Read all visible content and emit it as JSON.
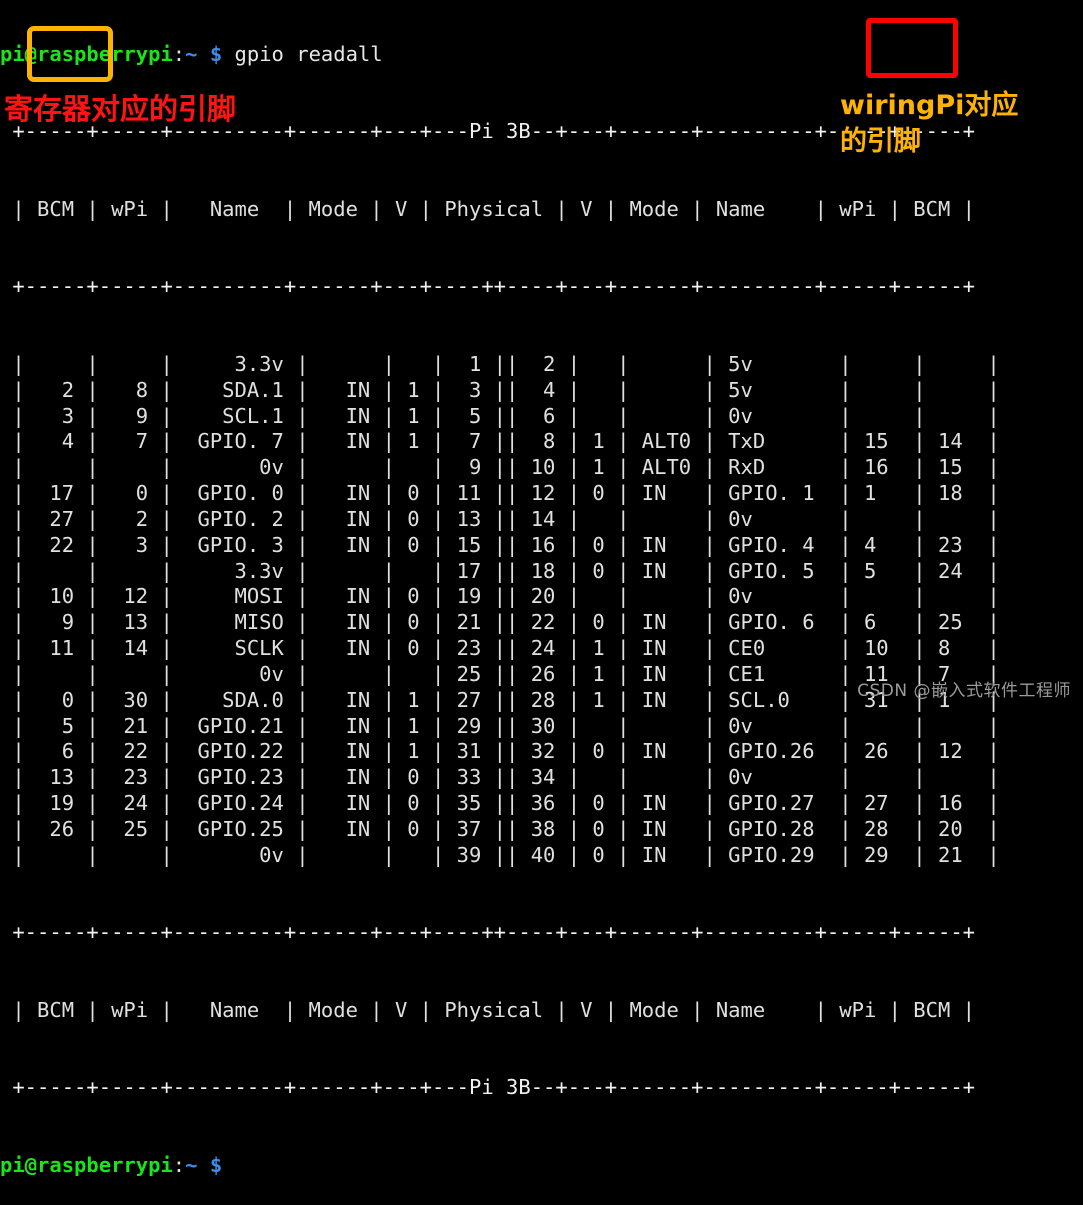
{
  "terminal": {
    "prompt": {
      "user_host": "pi@raspberrypi",
      "colon": ":",
      "path": "~",
      "dollar": "$"
    },
    "command": "gpio readall",
    "board_label": "Pi 3B",
    "top_line_full": "pi@raspberrypi:~ $ gpio readall",
    "final_prompt_trailing": " "
  },
  "table": {
    "headers": [
      "BCM",
      "wPi",
      "Name",
      "Mode",
      "V",
      "Physical",
      "V",
      "Mode",
      "Name",
      "wPi",
      "BCM"
    ],
    "border_top": " +-----+-----+---------+------+---+---Pi 3B--+---+------+---------+-----+-----+",
    "border_mid": " +-----+-----+---------+------+---+----++----+---+------+---------+-----+-----+",
    "header_row": " | BCM | wPi |   Name  | Mode | V | Physical | V | Mode | Name    | wPi | BCM |",
    "border_bottom": " +-----+-----+---------+------+---+---Pi 3B--+---+------+---------+-----+-----+",
    "rows": [
      {
        "bcm_l": "",
        "wpi_l": "",
        "name_l": "    3.3v",
        "mode_l": "",
        "v_l": "",
        "phys_l": " 1",
        "phys_r": " 2",
        "v_r": "",
        "mode_r": "",
        "name_r": "5v      ",
        "wpi_r": "",
        "bcm_r": ""
      },
      {
        "bcm_l": "2",
        "wpi_l": "8",
        "name_l": "   SDA.1",
        "mode_l": "  IN",
        "v_l": "1",
        "phys_l": " 3",
        "phys_r": " 4",
        "v_r": "",
        "mode_r": "",
        "name_r": "5v      ",
        "wpi_r": "",
        "bcm_r": ""
      },
      {
        "bcm_l": "3",
        "wpi_l": "9",
        "name_l": "   SCL.1",
        "mode_l": "  IN",
        "v_l": "1",
        "phys_l": " 5",
        "phys_r": " 6",
        "v_r": "",
        "mode_r": "",
        "name_r": "0v      ",
        "wpi_r": "",
        "bcm_r": ""
      },
      {
        "bcm_l": "4",
        "wpi_l": "7",
        "name_l": " GPIO. 7",
        "mode_l": "  IN",
        "v_l": "1",
        "phys_l": " 7",
        "phys_r": " 8",
        "v_r": "1",
        "mode_r": "ALT0",
        "name_r": "TxD     ",
        "wpi_r": "15",
        "bcm_r": "14"
      },
      {
        "bcm_l": "",
        "wpi_l": "",
        "name_l": "      0v",
        "mode_l": "",
        "v_l": "",
        "phys_l": " 9",
        "phys_r": "10",
        "v_r": "1",
        "mode_r": "ALT0",
        "name_r": "RxD     ",
        "wpi_r": "16",
        "bcm_r": "15"
      },
      {
        "bcm_l": "17",
        "wpi_l": "0",
        "name_l": " GPIO. 0",
        "mode_l": "  IN",
        "v_l": "0",
        "phys_l": "11",
        "phys_r": "12",
        "v_r": "0",
        "mode_r": "IN  ",
        "name_r": "GPIO. 1 ",
        "wpi_r": "1",
        "bcm_r": "18"
      },
      {
        "bcm_l": "27",
        "wpi_l": "2",
        "name_l": " GPIO. 2",
        "mode_l": "  IN",
        "v_l": "0",
        "phys_l": "13",
        "phys_r": "14",
        "v_r": "",
        "mode_r": "",
        "name_r": "0v      ",
        "wpi_r": "",
        "bcm_r": ""
      },
      {
        "bcm_l": "22",
        "wpi_l": "3",
        "name_l": " GPIO. 3",
        "mode_l": "  IN",
        "v_l": "0",
        "phys_l": "15",
        "phys_r": "16",
        "v_r": "0",
        "mode_r": "IN  ",
        "name_r": "GPIO. 4 ",
        "wpi_r": "4",
        "bcm_r": "23"
      },
      {
        "bcm_l": "",
        "wpi_l": "",
        "name_l": "    3.3v",
        "mode_l": "",
        "v_l": "",
        "phys_l": "17",
        "phys_r": "18",
        "v_r": "0",
        "mode_r": "IN  ",
        "name_r": "GPIO. 5 ",
        "wpi_r": "5",
        "bcm_r": "24"
      },
      {
        "bcm_l": "10",
        "wpi_l": "12",
        "name_l": "    MOSI",
        "mode_l": "  IN",
        "v_l": "0",
        "phys_l": "19",
        "phys_r": "20",
        "v_r": "",
        "mode_r": "",
        "name_r": "0v      ",
        "wpi_r": "",
        "bcm_r": ""
      },
      {
        "bcm_l": "9",
        "wpi_l": "13",
        "name_l": "    MISO",
        "mode_l": "  IN",
        "v_l": "0",
        "phys_l": "21",
        "phys_r": "22",
        "v_r": "0",
        "mode_r": "IN  ",
        "name_r": "GPIO. 6 ",
        "wpi_r": "6",
        "bcm_r": "25"
      },
      {
        "bcm_l": "11",
        "wpi_l": "14",
        "name_l": "    SCLK",
        "mode_l": "  IN",
        "v_l": "0",
        "phys_l": "23",
        "phys_r": "24",
        "v_r": "1",
        "mode_r": "IN  ",
        "name_r": "CE0     ",
        "wpi_r": "10",
        "bcm_r": "8"
      },
      {
        "bcm_l": "",
        "wpi_l": "",
        "name_l": "      0v",
        "mode_l": "",
        "v_l": "",
        "phys_l": "25",
        "phys_r": "26",
        "v_r": "1",
        "mode_r": "IN  ",
        "name_r": "CE1     ",
        "wpi_r": "11",
        "bcm_r": "7"
      },
      {
        "bcm_l": "0",
        "wpi_l": "30",
        "name_l": "   SDA.0",
        "mode_l": "  IN",
        "v_l": "1",
        "phys_l": "27",
        "phys_r": "28",
        "v_r": "1",
        "mode_r": "IN  ",
        "name_r": "SCL.0   ",
        "wpi_r": "31",
        "bcm_r": "1"
      },
      {
        "bcm_l": "5",
        "wpi_l": "21",
        "name_l": " GPIO.21",
        "mode_l": "  IN",
        "v_l": "1",
        "phys_l": "29",
        "phys_r": "30",
        "v_r": "",
        "mode_r": "",
        "name_r": "0v      ",
        "wpi_r": "",
        "bcm_r": ""
      },
      {
        "bcm_l": "6",
        "wpi_l": "22",
        "name_l": " GPIO.22",
        "mode_l": "  IN",
        "v_l": "1",
        "phys_l": "31",
        "phys_r": "32",
        "v_r": "0",
        "mode_r": "IN  ",
        "name_r": "GPIO.26 ",
        "wpi_r": "26",
        "bcm_r": "12"
      },
      {
        "bcm_l": "13",
        "wpi_l": "23",
        "name_l": " GPIO.23",
        "mode_l": "  IN",
        "v_l": "0",
        "phys_l": "33",
        "phys_r": "34",
        "v_r": "",
        "mode_r": "",
        "name_r": "0v      ",
        "wpi_r": "",
        "bcm_r": ""
      },
      {
        "bcm_l": "19",
        "wpi_l": "24",
        "name_l": " GPIO.24",
        "mode_l": "  IN",
        "v_l": "0",
        "phys_l": "35",
        "phys_r": "36",
        "v_r": "0",
        "mode_r": "IN  ",
        "name_r": "GPIO.27 ",
        "wpi_r": "27",
        "bcm_r": "16"
      },
      {
        "bcm_l": "26",
        "wpi_l": "25",
        "name_l": " GPIO.25",
        "mode_l": "  IN",
        "v_l": "0",
        "phys_l": "37",
        "phys_r": "38",
        "v_r": "0",
        "mode_r": "IN  ",
        "name_r": "GPIO.28 ",
        "wpi_r": "28",
        "bcm_r": "20"
      },
      {
        "bcm_l": "",
        "wpi_l": "",
        "name_l": "      0v",
        "mode_l": "",
        "v_l": "",
        "phys_l": "39",
        "phys_r": "40",
        "v_r": "0",
        "mode_r": "IN  ",
        "name_r": "GPIO.29 ",
        "wpi_r": "29",
        "bcm_r": "21"
      }
    ]
  },
  "annotations": {
    "bcm_note": "寄存器对应的引脚",
    "wpi_note": "wiringPi对应\n的引脚",
    "bcm_note_color": "#ff1313",
    "wpi_note_color": "#ffb300",
    "bcm_box_color": "#ffb300",
    "wpi_box_color": "#ff0000"
  },
  "watermark": "CSDN @嵌入式软件工程师"
}
